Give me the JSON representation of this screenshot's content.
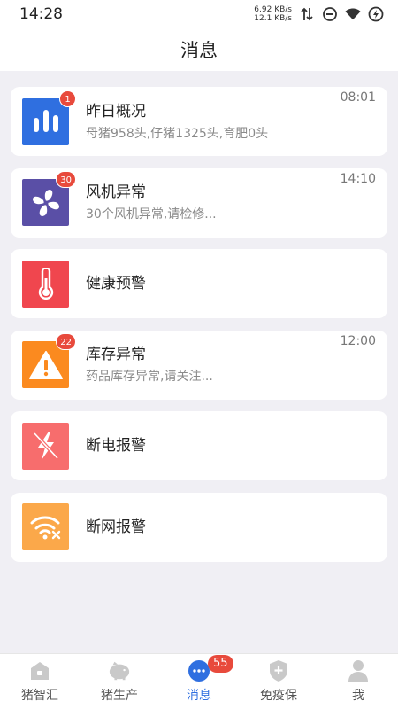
{
  "status_bar": {
    "time": "14:28",
    "net_up": "6.92 KB/s",
    "net_down": "12.1 KB/s",
    "icons": [
      "data-arrows-icon",
      "do-not-disturb-icon",
      "wifi-icon",
      "battery-icon"
    ]
  },
  "header": {
    "title": "消息"
  },
  "messages": [
    {
      "title": "昨日概况",
      "subtitle": "母猪958头,仔猪1325头,育肥0头",
      "time": "08:01",
      "badge": "1",
      "icon": "bar-chart-icon",
      "color": "#2f6fe0"
    },
    {
      "title": "风机异常",
      "subtitle": "30个风机异常,请检修...",
      "time": "14:10",
      "badge": "30",
      "icon": "fan-icon",
      "color": "#5a4fa6"
    },
    {
      "title": "健康预警",
      "subtitle": "",
      "time": "",
      "badge": "",
      "icon": "thermometer-icon",
      "color": "#f0464e"
    },
    {
      "title": "库存异常",
      "subtitle": "药品库存异常,请关注...",
      "time": "12:00",
      "badge": "22",
      "icon": "warning-icon",
      "color": "#fb8a1f"
    },
    {
      "title": "断电报警",
      "subtitle": "",
      "time": "",
      "badge": "",
      "icon": "power-off-icon",
      "color": "#f76d6d"
    },
    {
      "title": "断网报警",
      "subtitle": "",
      "time": "",
      "badge": "",
      "icon": "wifi-off-icon",
      "color": "#fba84a"
    }
  ],
  "tab_bar": {
    "tabs": [
      {
        "label": "猪智汇",
        "icon": "home-icon",
        "active": false
      },
      {
        "label": "猪生产",
        "icon": "pig-icon",
        "active": false
      },
      {
        "label": "消息",
        "icon": "message-icon",
        "active": true,
        "badge": "55"
      },
      {
        "label": "免疫保",
        "icon": "shield-icon",
        "active": false
      },
      {
        "label": "我",
        "icon": "person-icon",
        "active": false
      }
    ]
  }
}
